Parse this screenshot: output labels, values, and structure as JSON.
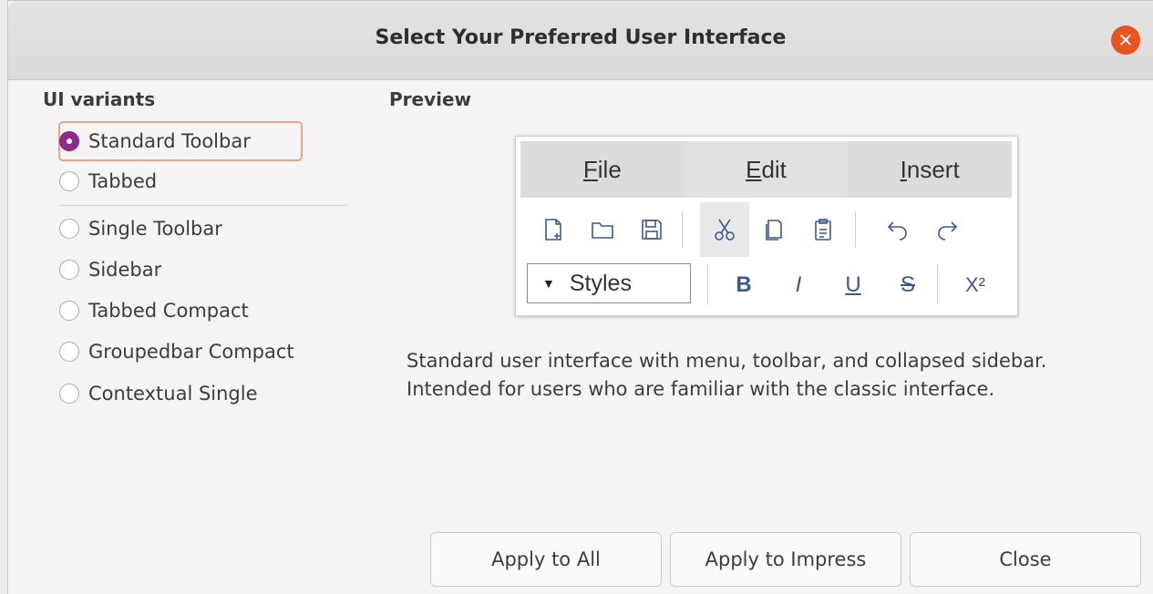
{
  "dialog": {
    "title": "Select Your Preferred User Interface",
    "close_glyph": "✕"
  },
  "variants": {
    "heading": "UI variants",
    "items": [
      {
        "label": "Standard Toolbar",
        "checked": true
      },
      {
        "label": "Tabbed",
        "checked": false
      },
      {
        "label": "Single Toolbar",
        "checked": false
      },
      {
        "label": "Sidebar",
        "checked": false
      },
      {
        "label": "Tabbed Compact",
        "checked": false
      },
      {
        "label": "Groupedbar Compact",
        "checked": false
      },
      {
        "label": "Contextual Single",
        "checked": false
      }
    ]
  },
  "preview": {
    "heading": "Preview",
    "menu": [
      {
        "mnemonic": "F",
        "rest": "ile"
      },
      {
        "mnemonic": "E",
        "rest": "dit"
      },
      {
        "mnemonic": "I",
        "rest": "nsert"
      }
    ],
    "toolbar_icons": [
      "new-document-icon",
      "open-folder-icon",
      "save-icon",
      "cut-icon",
      "copy-icon",
      "paste-icon",
      "undo-icon",
      "redo-icon"
    ],
    "styles_arrow": "▼",
    "styles_label": "Styles",
    "format": {
      "bold": "B",
      "italic": "I",
      "underline": "U",
      "strike": "S",
      "superscript": "X²"
    }
  },
  "description": "Standard user interface with menu, toolbar, and collapsed sidebar. Intended for users who are familiar with the classic interface.",
  "buttons": {
    "apply_all": "Apply to All",
    "apply_impress": "Apply to Impress",
    "close": "Close"
  },
  "colors": {
    "accent": "#8e2c8e",
    "close_button": "#e95420",
    "focus_ring": "#e8a58d"
  }
}
